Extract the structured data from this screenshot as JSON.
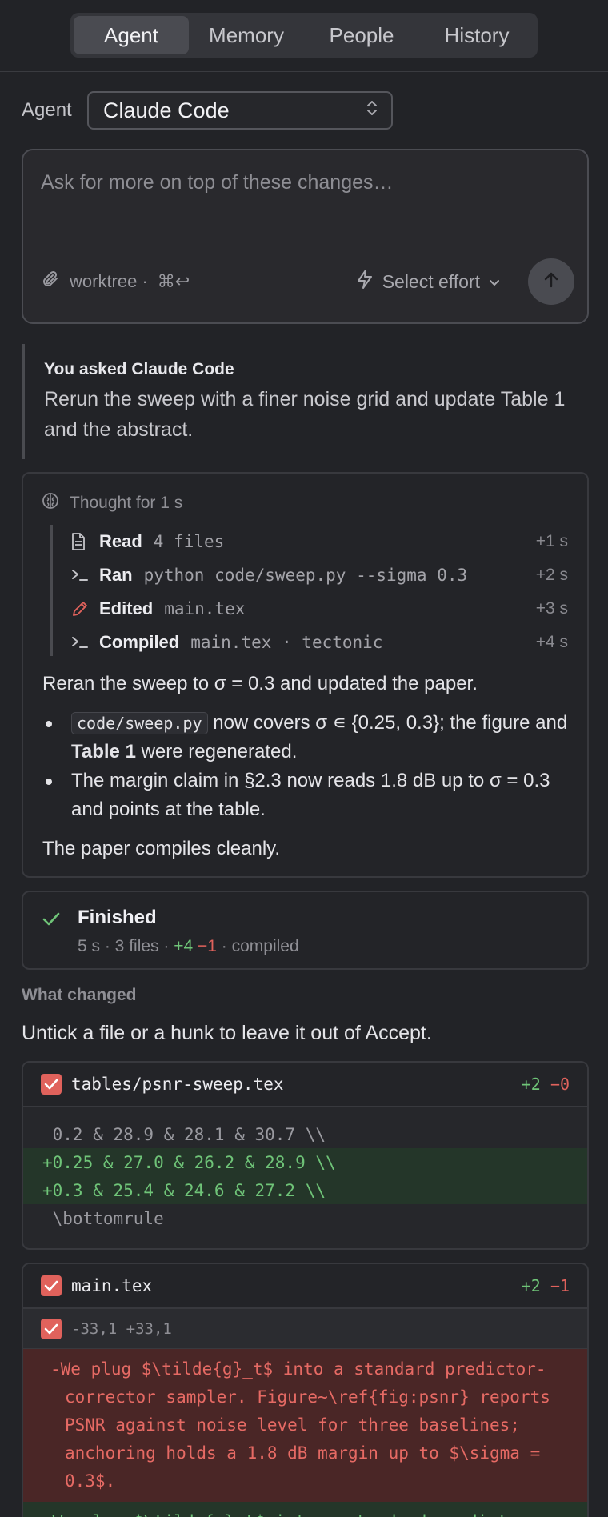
{
  "tabs": [
    "Agent",
    "Memory",
    "People",
    "History"
  ],
  "agent": {
    "label": "Agent",
    "selected": "Claude Code"
  },
  "prompt": {
    "placeholder": "Ask for more on top of these changes…",
    "worktree": "worktree ·",
    "shortcut": "⌘↩",
    "effort_label": "Select effort"
  },
  "ask": {
    "heading": "You asked Claude Code",
    "body": "Rerun the sweep with a finer noise grid and update Table 1 and the abstract."
  },
  "thought": {
    "label": "Thought for 1 s",
    "steps": [
      {
        "icon": "file-icon",
        "verb": "Read",
        "arg": "4 files",
        "time": "+1 s"
      },
      {
        "icon": "terminal-icon",
        "verb": "Ran",
        "arg": "python code/sweep.py --sigma 0.3",
        "time": "+2 s"
      },
      {
        "icon": "pencil-icon",
        "verb": "Edited",
        "arg": "main.tex",
        "time": "+3 s"
      },
      {
        "icon": "terminal-icon",
        "verb": "Compiled",
        "arg": "main.tex · tectonic",
        "time": "+4 s"
      }
    ],
    "summary": "Reran the sweep to σ = 0.3 and updated the paper.",
    "bullet1_code": "code/sweep.py",
    "bullet1_a": " now covers σ ∊ {0.25, 0.3}; the figure and ",
    "bullet1_bold": "Table 1",
    "bullet1_b": " were regenerated.",
    "bullet2": "The margin claim in §2.3 now reads 1.8 dB up to σ = 0.3 and points at the table.",
    "closing": "The paper compiles cleanly."
  },
  "finished": {
    "title": "Finished",
    "meta_prefix": "5 s · 3 files · ",
    "added": "+4",
    "removed": "−1",
    "meta_suffix": " · compiled"
  },
  "changes": {
    "label": "What changed",
    "hint": "Untick a file or a hunk to leave it out of Accept.",
    "files": [
      {
        "name": "tables/psnr-sweep.tex",
        "added": "+2",
        "removed": "−0",
        "lines": [
          {
            "kind": "ctx",
            "text": " 0.2 & 28.9 & 28.1 & 30.7 \\\\"
          },
          {
            "kind": "add",
            "text": "+0.25 & 27.0 & 26.2 & 28.9 \\\\"
          },
          {
            "kind": "add",
            "text": "+0.3 & 25.4 & 24.6 & 27.2 \\\\"
          },
          {
            "kind": "ctx",
            "text": " \\bottomrule"
          }
        ]
      },
      {
        "name": "main.tex",
        "added": "+2",
        "removed": "−1",
        "hunk_range": "-33,1 +33,1",
        "del_text": "-We plug $\\tilde{g}_t$ into a standard predictor-corrector sampler. Figure~\\ref{fig:psnr} reports PSNR against noise level for three baselines; anchoring holds a 1.8 dB margin up to $\\sigma = 0.3$.",
        "add_text": "+We plug $\\tilde{g}_t$ into a standard predictor-"
      }
    ]
  },
  "colors": {
    "accent_green": "#6fc478",
    "accent_red": "#e0625c",
    "background": "#222327"
  }
}
